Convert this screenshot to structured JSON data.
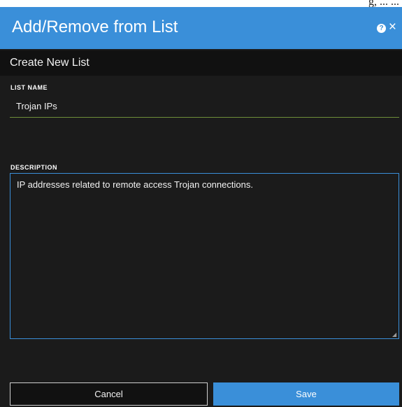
{
  "background_caption": "g, ... ...",
  "dialog": {
    "title": "Add/Remove from List",
    "help_glyph": "?",
    "close_glyph": "×",
    "subheader": "Create New List",
    "list_name": {
      "label": "LIST NAME",
      "value": "Trojan IPs"
    },
    "description": {
      "label": "DESCRIPTION",
      "value": "IP addresses related to remote access Trojan connections."
    },
    "buttons": {
      "cancel": "Cancel",
      "save": "Save"
    }
  },
  "icons": {
    "help": "help-circle-icon",
    "close": "close-icon",
    "resize": "resize-grip-icon"
  },
  "colors": {
    "accent": "#3a8fd9",
    "panel": "#1b1b1b",
    "subheader": "#111111",
    "name_underline": "#6e8e3a"
  }
}
